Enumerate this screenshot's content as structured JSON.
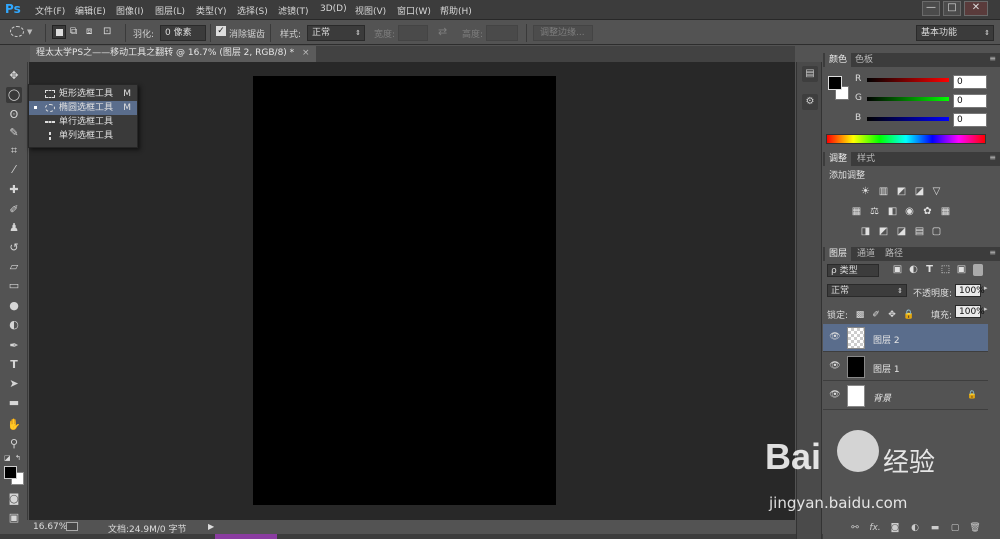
{
  "app": {
    "logo": "Ps"
  },
  "menu": [
    "文件(F)",
    "编辑(E)",
    "图像(I)",
    "图层(L)",
    "类型(Y)",
    "选择(S)",
    "滤镜(T)",
    "3D(D)",
    "视图(V)",
    "窗口(W)",
    "帮助(H)"
  ],
  "window_controls": {
    "minimize": "—",
    "restore": "□",
    "close": "✕"
  },
  "options": {
    "feather_label": "羽化:",
    "feather_value": "0 像素",
    "antialias_label": "消除锯齿",
    "antialias_checked": true,
    "style_label": "样式:",
    "style_value": "正常",
    "width_label": "宽度:",
    "height_label": "高度:",
    "refine_edge_label": "调整边缘...",
    "workspace": "基本功能"
  },
  "document_tab": {
    "title": "程太太学PS之——移动工具之翻转 @ 16.7% (图层 2, RGB/8) *",
    "close": "×"
  },
  "tool_flyout": {
    "items": [
      {
        "label": "矩形选框工具",
        "key": "M",
        "selected": false
      },
      {
        "label": "椭圆选框工具",
        "key": "M",
        "selected": true
      },
      {
        "label": "单行选框工具",
        "key": "",
        "selected": false
      },
      {
        "label": "单列选框工具",
        "key": "",
        "selected": false
      }
    ]
  },
  "status": {
    "zoom": "16.67%",
    "doc_size": "文档:24.9M/0 字节",
    "arrow": "▶"
  },
  "color_panel": {
    "tabs": [
      "颜色",
      "色板"
    ],
    "channels": [
      {
        "label": "R",
        "value": "0"
      },
      {
        "label": "G",
        "value": "0"
      },
      {
        "label": "B",
        "value": "0"
      }
    ],
    "foreground": "#000000",
    "background": "#ffffff"
  },
  "adjustments_panel": {
    "tabs": [
      "调整",
      "样式"
    ],
    "title": "添加调整",
    "icons_row1": [
      "brightness-icon",
      "levels-icon",
      "curves-icon",
      "exposure-icon",
      "vibrance-icon"
    ],
    "icons_row2": [
      "hue-saturation-icon",
      "color-balance-icon",
      "black-white-icon",
      "photo-filter-icon",
      "channel-mixer-icon",
      "color-lookup-icon"
    ],
    "icons_row3": [
      "invert-icon",
      "posterize-icon",
      "threshold-icon",
      "gradient-map-icon",
      "selective-color-icon"
    ]
  },
  "layers_panel": {
    "tabs": [
      "图层",
      "通道",
      "路径"
    ],
    "filter_label": "ρ 类型",
    "blend_mode": "正常",
    "opacity_label": "不透明度:",
    "opacity_value": "100%",
    "lock_label": "锁定:",
    "fill_label": "填充:",
    "fill_value": "100%",
    "layers": [
      {
        "name": "图层 2",
        "selected": true,
        "thumb": "transparent",
        "italic": false
      },
      {
        "name": "图层 1",
        "selected": false,
        "thumb": "black",
        "italic": false
      },
      {
        "name": "背景",
        "selected": false,
        "thumb": "white",
        "italic": true
      }
    ],
    "footer_icons": [
      "link-icon",
      "fx-icon",
      "mask-icon",
      "adjustment-layer-icon",
      "group-icon",
      "new-layer-icon",
      "delete-icon"
    ],
    "footer_fx": "fx."
  },
  "watermark": {
    "brand": "Bai",
    "suffix": "经验",
    "url": "jingyan.baidu.com"
  },
  "colors": {
    "selection": "#5a6d8c",
    "canvas_bg": "#282828",
    "ui_bg": "#535353"
  }
}
